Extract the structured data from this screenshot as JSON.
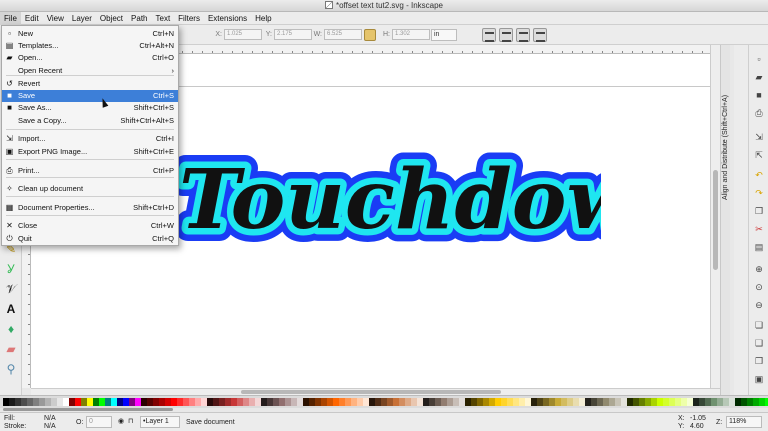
{
  "window": {
    "title": "*offset text tut2.svg - Inkscape"
  },
  "menubar": [
    "File",
    "Edit",
    "View",
    "Layer",
    "Object",
    "Path",
    "Text",
    "Filters",
    "Extensions",
    "Help"
  ],
  "controls": {
    "x_label": "X:",
    "x_value": "1.025",
    "y_label": "Y:",
    "y_value": "2.175",
    "w_label": "W:",
    "w_value": "6.525",
    "h_label": "H:",
    "h_value": "1.302",
    "units": "in"
  },
  "file_menu": {
    "items": [
      {
        "icon": "new-document-icon",
        "glyph": "▫",
        "label": "New",
        "shortcut": "Ctrl+N"
      },
      {
        "icon": "templates-icon",
        "glyph": "▤",
        "label": "Templates...",
        "shortcut": "Ctrl+Alt+N"
      },
      {
        "icon": "open-folder-icon",
        "glyph": "▰",
        "label": "Open...",
        "shortcut": "Ctrl+O"
      },
      {
        "icon": "",
        "glyph": "",
        "label": "Open Recent",
        "shortcut": "›"
      },
      {
        "icon": "revert-icon",
        "glyph": "↺",
        "label": "Revert",
        "shortcut": ""
      },
      {
        "icon": "save-icon",
        "glyph": "■",
        "label": "Save",
        "shortcut": "Ctrl+S"
      },
      {
        "icon": "save-as-icon",
        "glyph": "■",
        "label": "Save As...",
        "shortcut": "Shift+Ctrl+S"
      },
      {
        "icon": "",
        "glyph": "",
        "label": "Save a Copy...",
        "shortcut": "Shift+Ctrl+Alt+S"
      },
      {
        "icon": "import-icon",
        "glyph": "⇲",
        "label": "Import...",
        "shortcut": "Ctrl+I"
      },
      {
        "icon": "export-png-icon",
        "glyph": "▣",
        "label": "Export PNG Image...",
        "shortcut": "Shift+Ctrl+E"
      },
      {
        "icon": "print-icon",
        "glyph": "⎙",
        "label": "Print...",
        "shortcut": "Ctrl+P"
      },
      {
        "icon": "clean-up-icon",
        "glyph": "✧",
        "label": "Clean up document",
        "shortcut": ""
      },
      {
        "icon": "document-properties-icon",
        "glyph": "▦",
        "label": "Document Properties...",
        "shortcut": "Shift+Ctrl+D"
      },
      {
        "icon": "close-icon",
        "glyph": "✕",
        "label": "Close",
        "shortcut": "Ctrl+W"
      },
      {
        "icon": "quit-icon",
        "glyph": "⏻",
        "label": "Quit",
        "shortcut": "Ctrl+Q"
      }
    ]
  },
  "canvas": {
    "text": "Touchdown",
    "colors": {
      "outer_offset": "#1a3cf5",
      "inner_offset": "#1fe6f0",
      "fill": "#111111"
    }
  },
  "dock": {
    "title": "Align and Distribute (Shift+Ctrl+A)"
  },
  "status": {
    "fill_label": "Fill:",
    "fill_value": "N/A",
    "stroke_label": "Stroke:",
    "stroke_value": "N/A",
    "opacity_label": "O:",
    "opacity_value": "0",
    "layer": "•Layer 1",
    "message": "Save document",
    "x_label": "X:",
    "x_value": "-1.05",
    "y_label": "Y:",
    "y_value": "4.60",
    "zoom_label": "Z:",
    "zoom_value": "118%"
  },
  "palette": [
    "#000000",
    "#1a1a1a",
    "#333333",
    "#4d4d4d",
    "#666666",
    "#808080",
    "#999999",
    "#b3b3b3",
    "#cccccc",
    "#e6e6e6",
    "#ffffff",
    "#800000",
    "#ff0000",
    "#808000",
    "#ffff00",
    "#008000",
    "#00ff00",
    "#008080",
    "#00ffff",
    "#000080",
    "#0000ff",
    "#800080",
    "#ff00ff",
    "#2b0000",
    "#550000",
    "#800000",
    "#aa0000",
    "#d40000",
    "#ff0000",
    "#ff2a2a",
    "#ff5555",
    "#ff8080",
    "#ffaaaa",
    "#ffd5d5",
    "#280b0b",
    "#501616",
    "#782121",
    "#a02c2c",
    "#c83737",
    "#d35f5f",
    "#de8787",
    "#e9afaf",
    "#f4d7d7",
    "#241c1c",
    "#483737",
    "#6c5353",
    "#916f6f",
    "#ac9393",
    "#c8b7b7",
    "#e3dbdb",
    "#2b1100",
    "#552200",
    "#803300",
    "#aa4400",
    "#d45500",
    "#ff6600",
    "#ff7f2a",
    "#ff9955",
    "#ffb380",
    "#ffccaa",
    "#ffe6d5",
    "#28170b",
    "#502d16",
    "#784421",
    "#a05a2c",
    "#c87137",
    "#d38d5f",
    "#deaa87",
    "#e9c6af",
    "#f4e3d7",
    "#241f1c",
    "#483e37",
    "#6c5d53",
    "#917c6f",
    "#ac9d93",
    "#c8beb7",
    "#e3dedb",
    "#2b2200",
    "#554400",
    "#806600",
    "#aa8800",
    "#d4aa00",
    "#ffcc00",
    "#ffd42a",
    "#ffdd55",
    "#ffe680",
    "#ffeeaa",
    "#fff6d5",
    "#28220b",
    "#504416",
    "#786721",
    "#a0892c",
    "#c8ab37",
    "#d3bc5f",
    "#decd87",
    "#e9ddaf",
    "#f4eed7",
    "#24221c",
    "#484537",
    "#6c6753",
    "#918a6f",
    "#aca793",
    "#c8c4b7",
    "#e3e2db",
    "#222b00",
    "#445500",
    "#668000",
    "#88aa00",
    "#aad400",
    "#ccff00",
    "#d4ff2a",
    "#ddff55",
    "#e5ff80",
    "#eeffaa",
    "#f6ffd5",
    "#1c241c",
    "#374837",
    "#536c53",
    "#6f916f",
    "#93ac93",
    "#b7c8b7",
    "#dbe3db",
    "#002b00",
    "#005500",
    "#008000",
    "#00aa00",
    "#00d400",
    "#00ff00",
    "#2aff2a",
    "#55ff55",
    "#80ff80",
    "#aaffaa",
    "#d5ffd5",
    "#0b2816",
    "#16502d",
    "#217844",
    "#2ca05a",
    "#37c871",
    "#5fd38d",
    "#87deaa",
    "#afe9c6",
    "#d7f4e3",
    "#002b22",
    "#005544",
    "#008066"
  ]
}
